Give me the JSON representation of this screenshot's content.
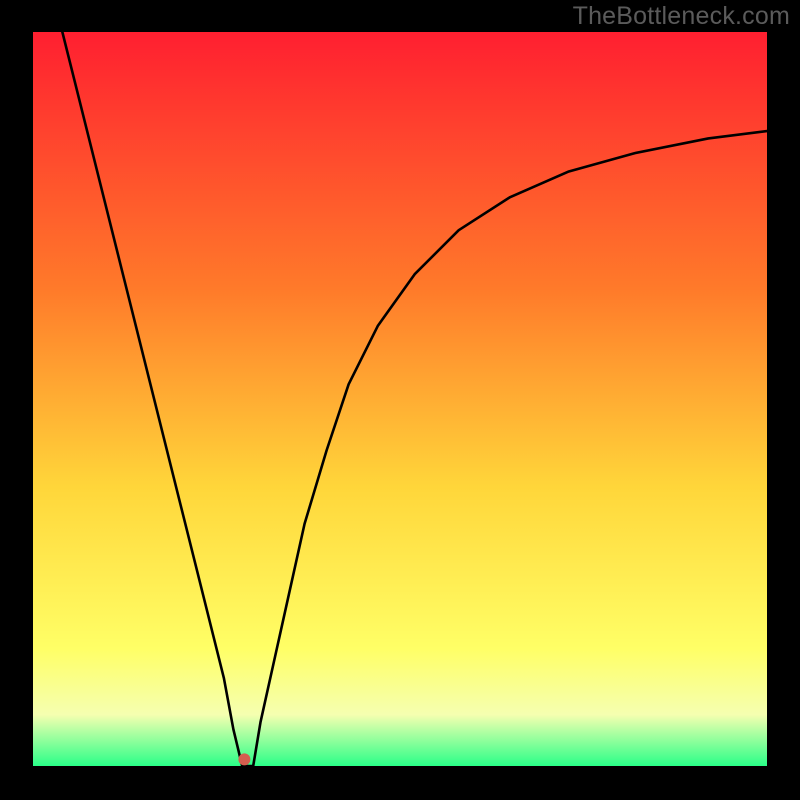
{
  "watermark": "TheBottleneck.com",
  "colors": {
    "frame": "#000000",
    "gradient_top": "#ff1f30",
    "gradient_mid1": "#ff7a2a",
    "gradient_mid2": "#ffd63a",
    "gradient_mid3": "#ffff66",
    "gradient_mid35": "#f5ffb0",
    "gradient_bottom": "#2aff88",
    "curve": "#000000",
    "dot": "#d45e4f"
  },
  "chart_data": {
    "type": "line",
    "title": "",
    "xlabel": "",
    "ylabel": "",
    "xlim": [
      0,
      100
    ],
    "ylim": [
      0,
      100
    ],
    "x": [
      4,
      6,
      8,
      10,
      12,
      14,
      16,
      18,
      20,
      22,
      24,
      26,
      27.3,
      28.5,
      30,
      31,
      33,
      35,
      37,
      40,
      43,
      47,
      52,
      58,
      65,
      73,
      82,
      92,
      100
    ],
    "values": [
      100,
      92,
      84,
      76,
      68,
      60,
      52,
      44,
      36,
      28,
      20,
      12,
      5,
      0,
      0,
      6,
      15,
      24,
      33,
      43,
      52,
      60,
      67,
      73,
      77.5,
      81,
      83.5,
      85.5,
      86.5
    ],
    "annotations": [
      {
        "type": "dot",
        "x": 28.8,
        "y": 0.9
      }
    ],
    "notes": "Gradient background red→green, V-shaped curve with minimum near x≈28.5 and asymptotic rise to the right; single marker dot near the curve minimum."
  }
}
